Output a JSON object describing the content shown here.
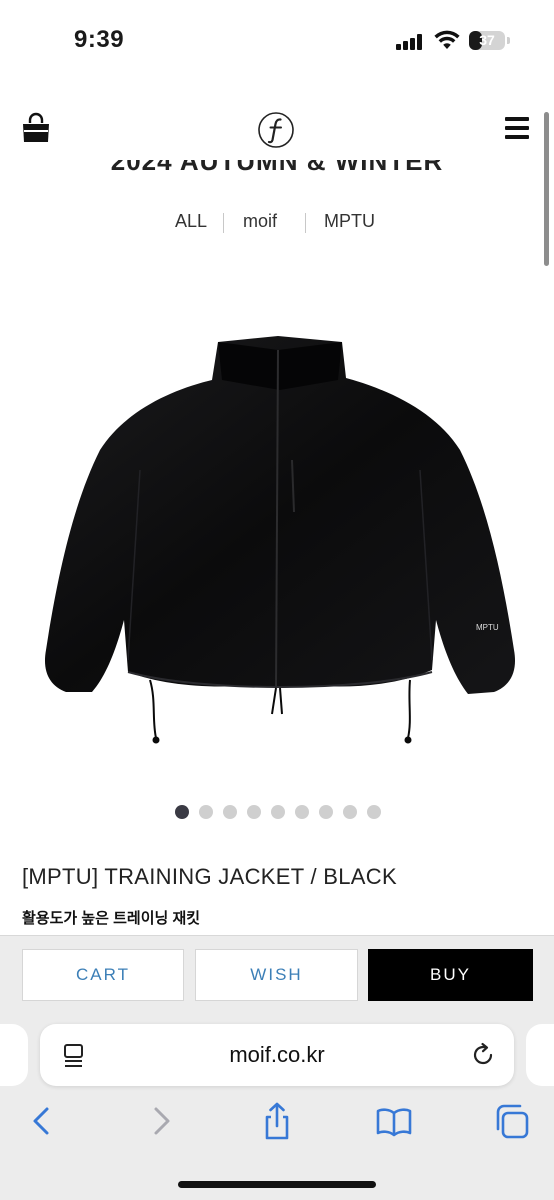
{
  "status_bar": {
    "time": "9:39",
    "battery_level": "37"
  },
  "header": {
    "logo_icon": "moif-logo",
    "cart_icon": "shopping-bag-icon",
    "menu_icon": "hamburger-menu-icon"
  },
  "season_title": "2024 AUTUMN & WINTER",
  "categories": [
    "ALL",
    "moif",
    "MPTU"
  ],
  "carousel": {
    "total_slides": 9,
    "active_index": 0
  },
  "product": {
    "title": "[MPTU] TRAINING JACKET / BLACK",
    "subtitle": "활용도가 높은 트레이닝 재킷",
    "image_print_text": "MPTU"
  },
  "actions": {
    "cart_label": "CART",
    "wish_label": "WISH",
    "buy_label": "BUY"
  },
  "browser": {
    "url": "moif.co.kr",
    "toolbar_icons": [
      "back-icon",
      "forward-icon",
      "share-icon",
      "bookmarks-icon",
      "tabs-icon"
    ]
  },
  "colors": {
    "accent_blue": "#3c7fb7",
    "buy_button": "#000000",
    "action_bar_bg": "#ececec",
    "dot_active": "#3a3a44",
    "dot_inactive": "#cfcfcf"
  }
}
